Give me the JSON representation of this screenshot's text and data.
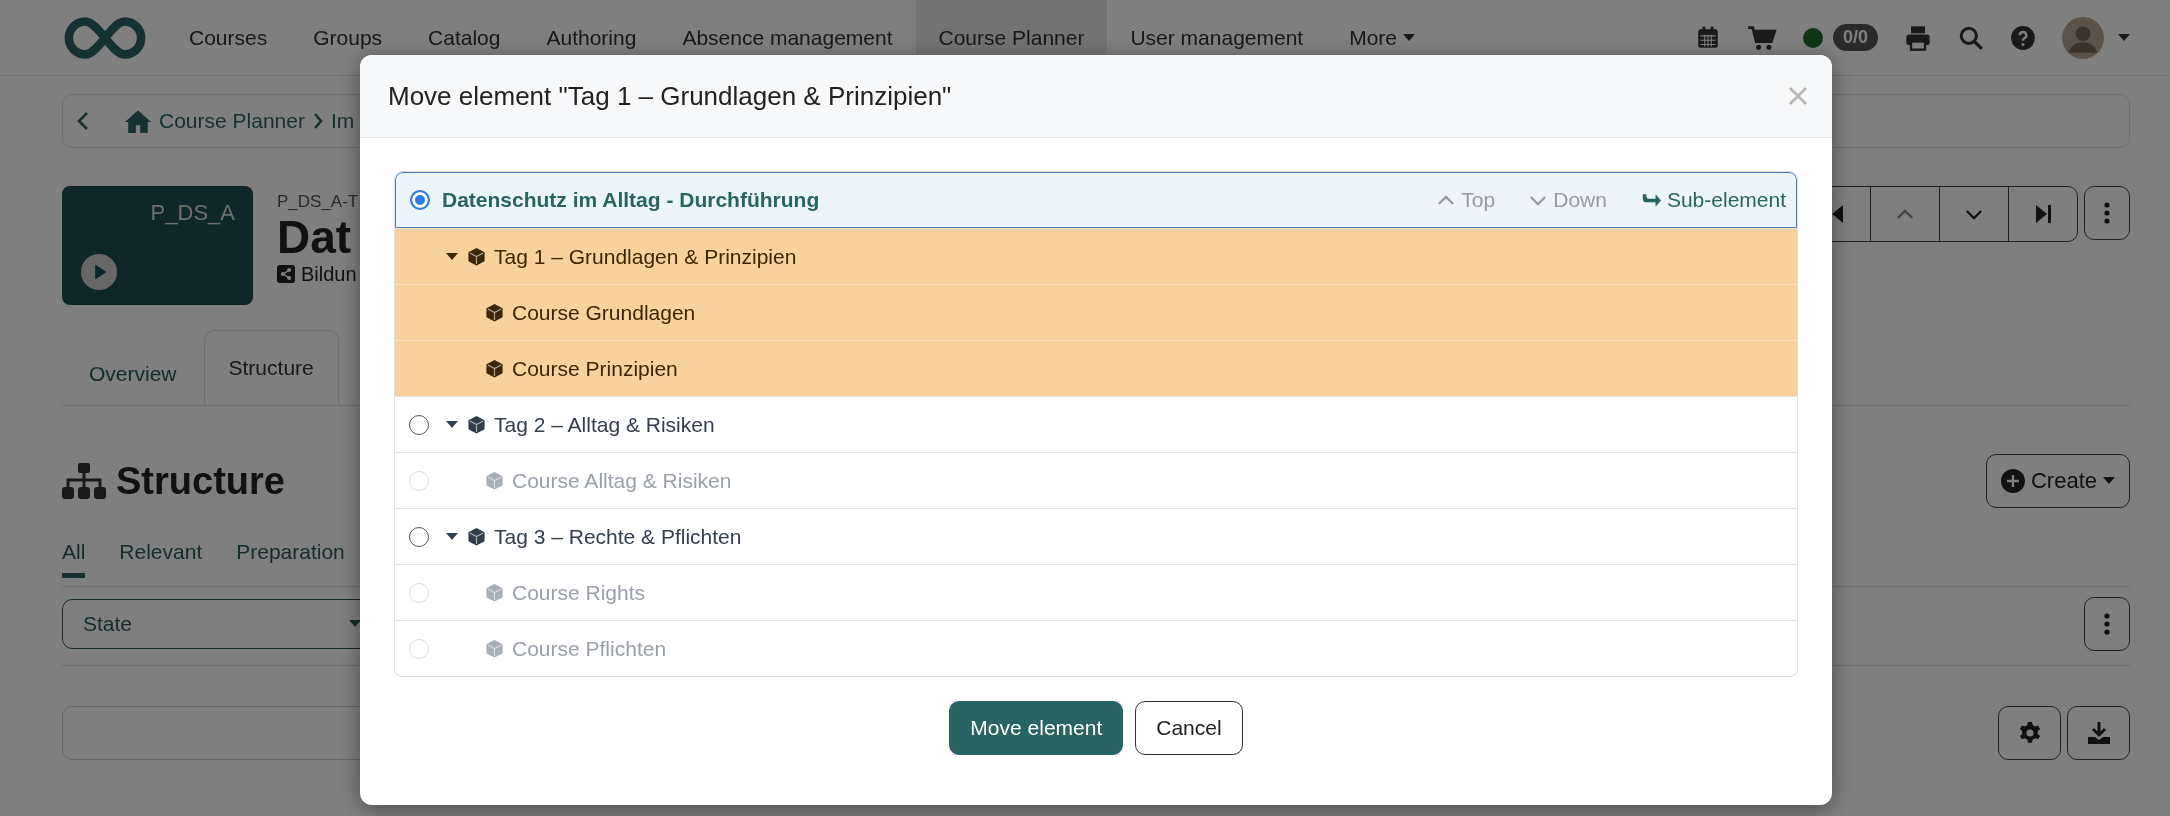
{
  "nav": {
    "items": [
      {
        "label": "Courses",
        "selected": false
      },
      {
        "label": "Groups",
        "selected": false
      },
      {
        "label": "Catalog",
        "selected": false
      },
      {
        "label": "Authoring",
        "selected": false
      },
      {
        "label": "Absence management",
        "selected": false
      },
      {
        "label": "Course Planner",
        "selected": true
      },
      {
        "label": "User management",
        "selected": false
      },
      {
        "label": "More",
        "selected": false
      }
    ],
    "badge": "0/0"
  },
  "breadcrumb": [
    "Course Planner",
    "Im"
  ],
  "header": {
    "thumb_label": "P_DS_A",
    "code": "P_DS_A-T",
    "title": "Dat",
    "subtitle": "Bildun"
  },
  "tabs": [
    {
      "label": "Overview",
      "selected": false
    },
    {
      "label": "Structure",
      "selected": true
    }
  ],
  "section_title": "Structure",
  "create_button": "Create",
  "filters": [
    {
      "label": "All",
      "selected": true
    },
    {
      "label": "Relevant",
      "selected": false
    },
    {
      "label": "Preparation",
      "selected": false
    }
  ],
  "state_select": "State",
  "dialog": {
    "title": "Move element \"Tag 1 – Grundlagen & Prinzipien\"",
    "actions": [
      {
        "label": "Top",
        "kind": "up",
        "disabled": true
      },
      {
        "label": "Down",
        "kind": "down",
        "disabled": true
      },
      {
        "label": "Sub-element",
        "kind": "sub",
        "disabled": false
      }
    ],
    "tree": {
      "label": "Datenschutz im Alltag - Durchführung",
      "selected": true,
      "moving": false,
      "disabled": false,
      "children": [
        {
          "label": "Tag 1 – Grundlagen & Prinzipien",
          "moving": true,
          "disabled": false,
          "expanded": true,
          "children": [
            {
              "label": "Course Grundlagen",
              "moving": true,
              "disabled": false
            },
            {
              "label": "Course Prinzipien",
              "moving": true,
              "disabled": false
            }
          ]
        },
        {
          "label": "Tag 2 – Alltag & Risiken",
          "selected": false,
          "moving": false,
          "disabled": false,
          "expanded": true,
          "children": [
            {
              "label": "Course Alltag & Risiken",
              "selected": false,
              "moving": false,
              "disabled": true
            }
          ]
        },
        {
          "label": "Tag 3 – Rechte & Pflichten",
          "selected": false,
          "moving": false,
          "disabled": false,
          "expanded": true,
          "children": [
            {
              "label": "Course Rights",
              "selected": false,
              "moving": false,
              "disabled": true
            },
            {
              "label": "Course Pflichten",
              "selected": false,
              "moving": false,
              "disabled": true
            }
          ]
        }
      ]
    },
    "buttons": [
      {
        "label": "Move element",
        "kind": "primary"
      },
      {
        "label": "Cancel",
        "kind": "default"
      }
    ]
  }
}
